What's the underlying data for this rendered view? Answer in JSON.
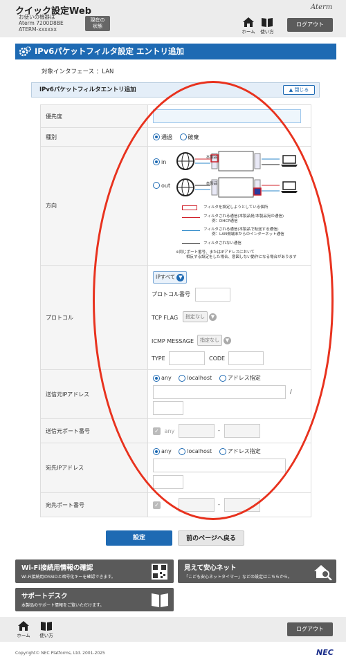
{
  "header": {
    "app_title": "クイック設定Web",
    "model_line1": "お使いの機器は",
    "model_line2": "Aterm 7200D8BE",
    "model_line3": "ATERM-xxxxxx",
    "status_line1": "現在の",
    "status_line2": "状態",
    "home_label": "ホーム",
    "howto_label": "使い方",
    "brand": "Aterm",
    "logout_label": "ログアウト"
  },
  "page": {
    "title": "IPv6パケットフィルタ設定 エントリ追加",
    "interface_text": "対象インタフェース ：LAN",
    "section_title": "IPv6パケットフィルタエントリ追加",
    "close_label": "閉じる"
  },
  "form": {
    "priority": {
      "label": "優先度",
      "value": ""
    },
    "type": {
      "label": "種別",
      "options": [
        "通過",
        "破棄"
      ],
      "selected": "通過"
    },
    "direction": {
      "label": "方向",
      "options": [
        "in",
        "out"
      ],
      "selected": "in",
      "device_label": "本製品",
      "legend": [
        "フィルタを設定しようとしている個所",
        "フィルタされる通信(本製品発/本製品宛の通信)",
        "例：DHCP通信",
        "フィルタされる通信(本製品で転送する通信)",
        "例：LAN側端末からのインターネット通信",
        "フィルタされない通信",
        "※同じポート番号、またはIPアドレスにおいて",
        "相反する設定をした場合、意図しない動作になる場合があります"
      ]
    },
    "protocol": {
      "label": "プロトコル",
      "select_value": "IPすべて",
      "protocol_number_label": "プロトコル番号",
      "tcp_flag_label": "TCP FLAG",
      "tcp_flag_value": "指定なし",
      "icmp_label": "ICMP MESSAGE",
      "icmp_value": "指定なし",
      "type_label": "TYPE",
      "code_label": "CODE"
    },
    "src_ip": {
      "label": "送信元IPアドレス",
      "options": [
        "any",
        "localhost",
        "アドレス指定"
      ],
      "selected": "any",
      "slash": "/"
    },
    "src_port": {
      "label": "送信元ポート番号",
      "any_label": "any",
      "dash": "-"
    },
    "dst_ip": {
      "label": "宛先IPアドレス",
      "options": [
        "any",
        "localhost",
        "アドレス指定"
      ],
      "selected": "any"
    },
    "dst_port": {
      "label": "宛先ポート番号",
      "dash": "-"
    }
  },
  "actions": {
    "set_label": "設定",
    "back_label": "前のページへ戻る"
  },
  "cards": {
    "wifi_title": "Wi-Fi接続用情報の確認",
    "wifi_sub": "Wi-Fi接続用のSSIDと暗号化キーを確認できます。",
    "kids_title": "見えて安心ネット",
    "kids_sub": "「こども安心ネットタイマー」などの設定はこちらから。",
    "support_title": "サポートデスク",
    "support_sub": "本製品のサポート情報をご覧いただけます。"
  },
  "footer": {
    "home_label": "ホーム",
    "howto_label": "使い方",
    "logout_label": "ログアウト",
    "copyright": "Copyright© NEC Platforms, Ltd. 2001-2025",
    "nec": "NEC"
  },
  "colors": {
    "accent": "#1e6ab3",
    "annotation": "#e8321e",
    "dark_button": "#5b5b5b"
  }
}
